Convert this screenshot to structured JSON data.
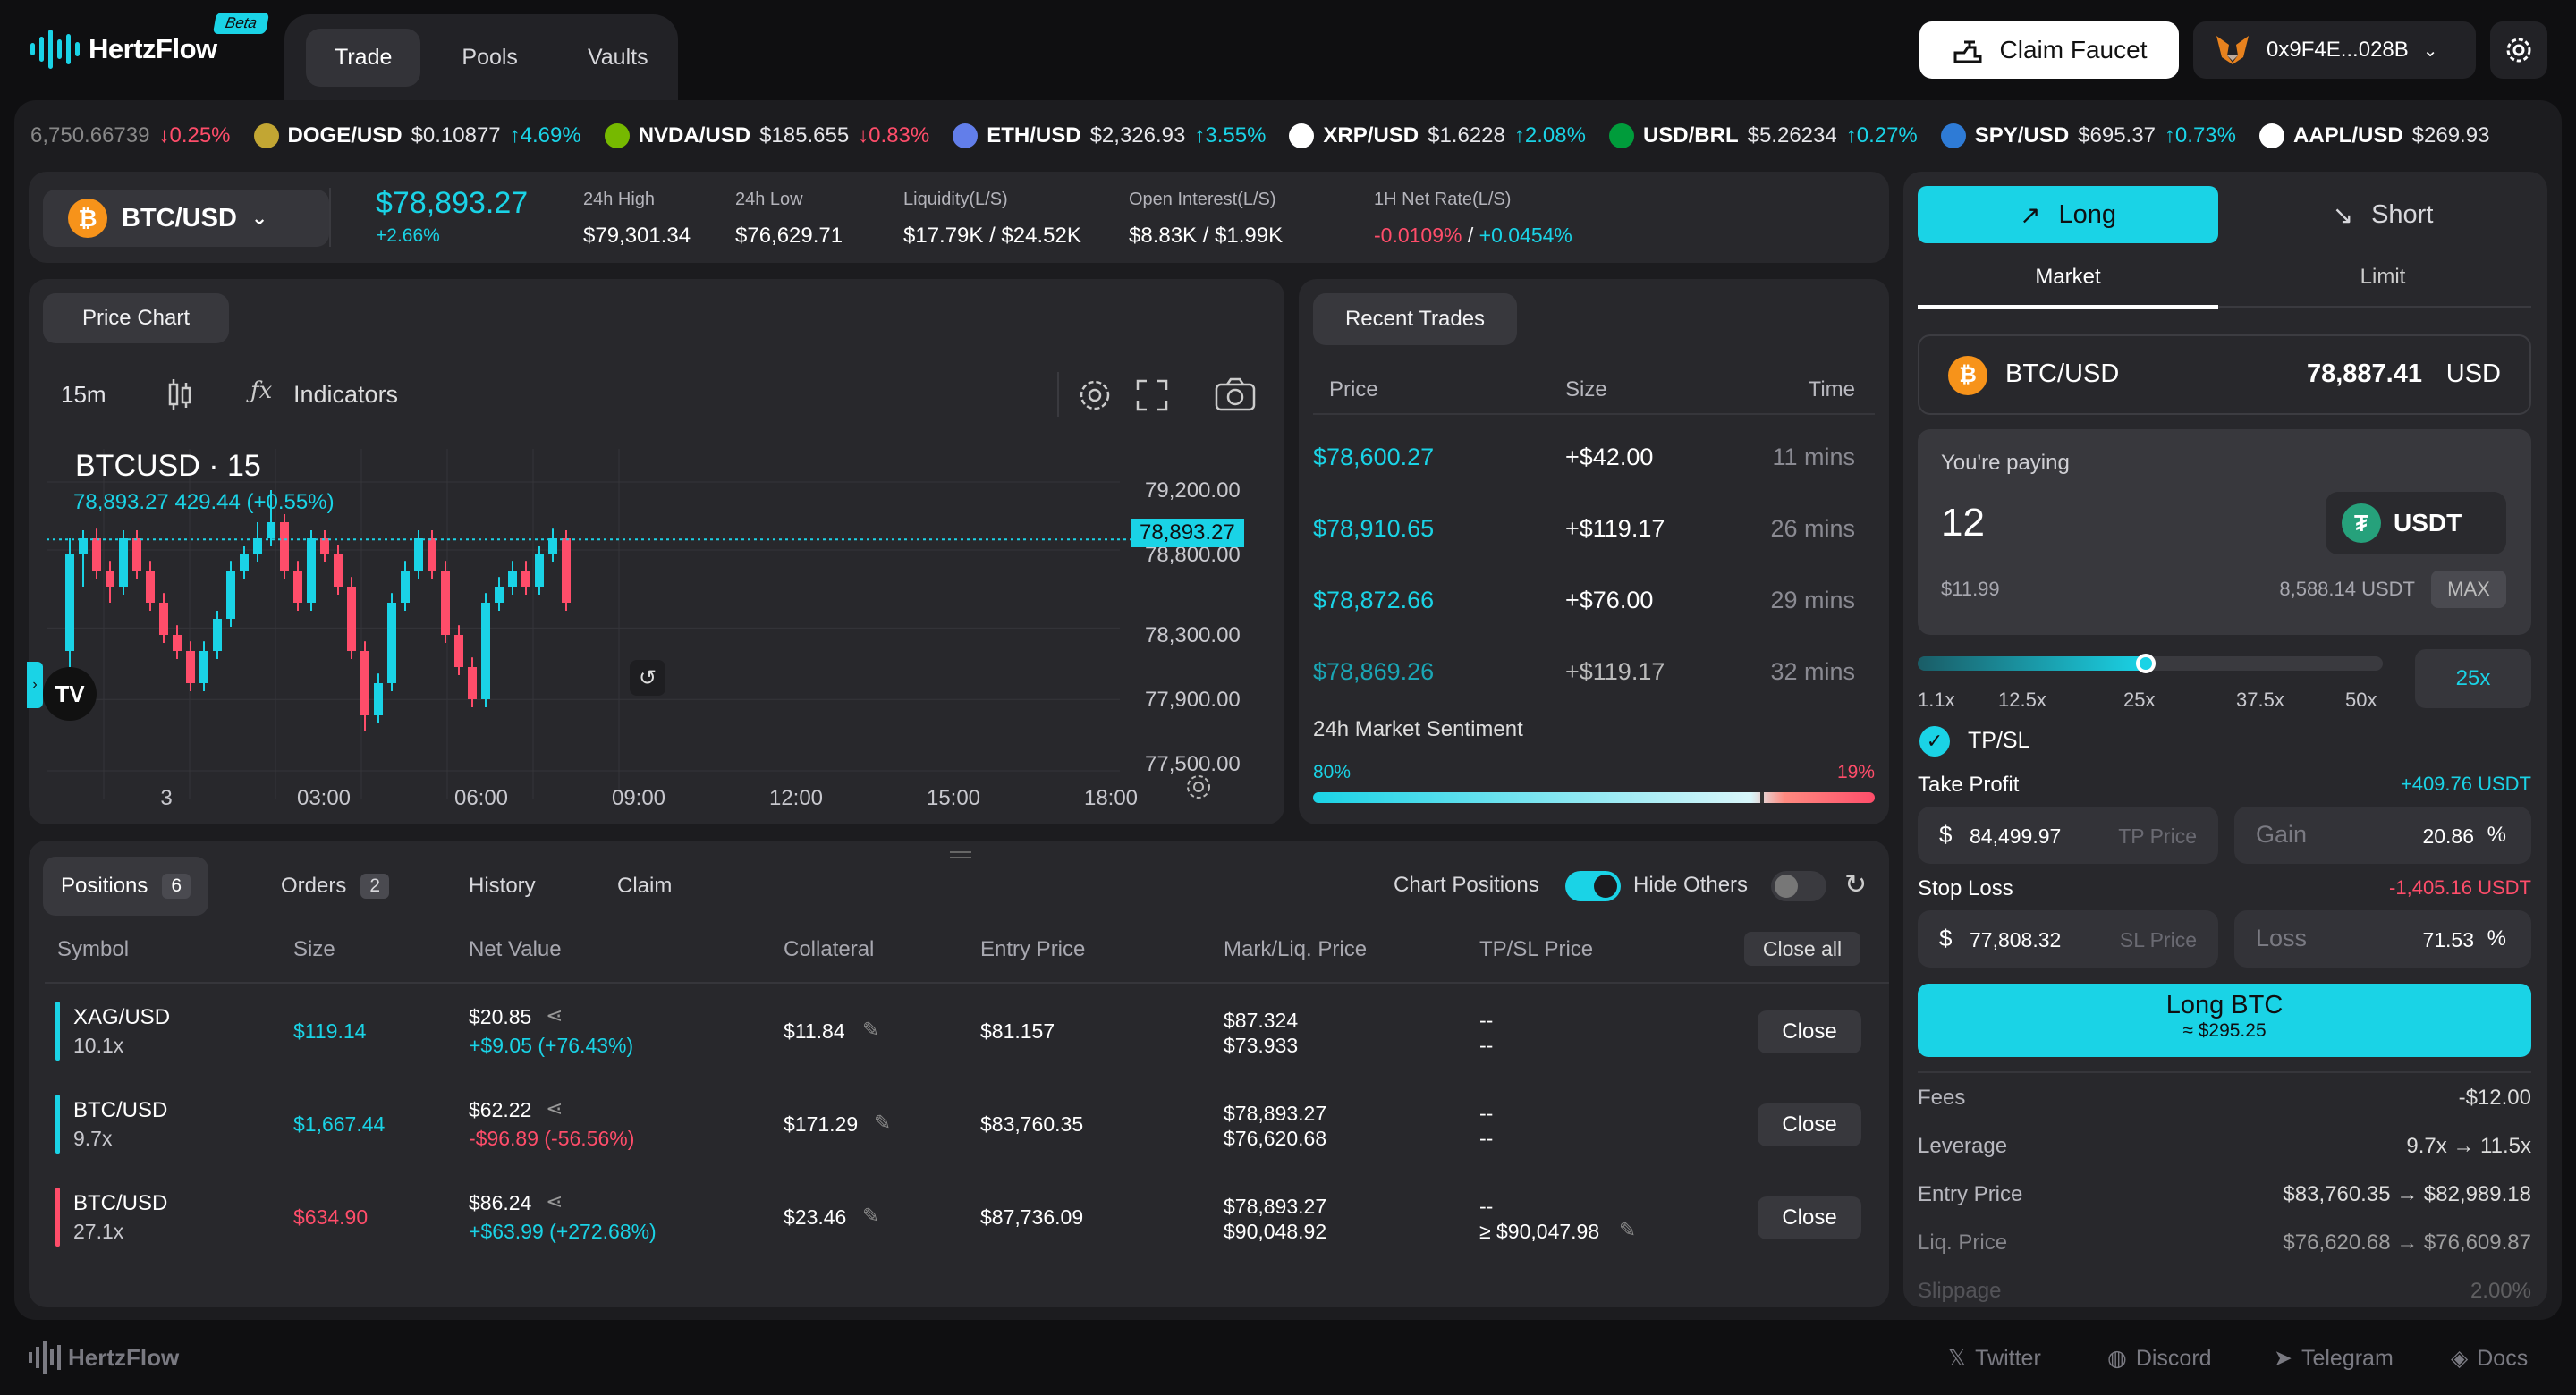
{
  "header": {
    "logo": "HertzFlow",
    "beta": "Beta",
    "tabs": [
      "Trade",
      "Pools",
      "Vaults"
    ],
    "claim_faucet": "Claim Faucet",
    "wallet": "0x9F4E...028B"
  },
  "ticker": [
    {
      "pair": "",
      "price": "6,750.66739",
      "change": "↓0.25%",
      "dir": "down",
      "icon": "none"
    },
    {
      "pair": "DOGE/USD",
      "price": "$0.10877",
      "change": "↑4.69%",
      "dir": "up",
      "icon": "doge-icon",
      "color": "#c2a633"
    },
    {
      "pair": "NVDA/USD",
      "price": "$185.655",
      "change": "↓0.83%",
      "dir": "down",
      "icon": "nvidia-icon",
      "color": "#76b900"
    },
    {
      "pair": "ETH/USD",
      "price": "$2,326.93",
      "change": "↑3.55%",
      "dir": "up",
      "icon": "eth-icon",
      "color": "#627eea"
    },
    {
      "pair": "XRP/USD",
      "price": "$1.6228",
      "change": "↑2.08%",
      "dir": "up",
      "icon": "xrp-icon",
      "color": "#ffffff"
    },
    {
      "pair": "USD/BRL",
      "price": "$5.26234",
      "change": "↑0.27%",
      "dir": "up",
      "icon": "brazil-flag-icon",
      "color": "#009c3b"
    },
    {
      "pair": "SPY/USD",
      "price": "$695.37",
      "change": "↑0.73%",
      "dir": "up",
      "icon": "spy-icon",
      "color": "#2e7bd6"
    },
    {
      "pair": "AAPL/USD",
      "price": "$269.93",
      "change": "",
      "dir": "up",
      "icon": "apple-icon",
      "color": "#ffffff"
    }
  ],
  "stats": {
    "pair": "BTC/USD",
    "price": "$78,893.27",
    "change": "+2.66%",
    "high_label": "24h High",
    "high": "$79,301.34",
    "low_label": "24h Low",
    "low": "$76,629.71",
    "liq_label": "Liquidity(L/S)",
    "liq": "$17.79K / $24.52K",
    "oi_label": "Open Interest(L/S)",
    "oi": "$8.83K / $1.99K",
    "rate_label": "1H Net Rate(L/S)",
    "rate_long": "-0.0109%",
    "rate_sep": " / ",
    "rate_short": "+0.0454%"
  },
  "chart": {
    "tab": "Price Chart",
    "interval": "15m",
    "indicators": "Indicators",
    "symbol": "BTCUSD · 15",
    "ohlc": "78,893.27  429.44 (+0.55%)",
    "price_tag": "78,893.27",
    "y_ticks": [
      "79,200.00",
      "78,800.00",
      "78,300.00",
      "77,900.00",
      "77,500.00"
    ],
    "x_ticks": [
      "3",
      "03:00",
      "06:00",
      "09:00",
      "12:00",
      "15:00",
      "18:00"
    ],
    "brand": "TV"
  },
  "chart_data": {
    "type": "candlestick",
    "title": "BTCUSD · 15",
    "ylim": [
      77400,
      79400
    ],
    "candles": [
      [
        78200,
        78800,
        78100,
        78900
      ],
      [
        78800,
        78900,
        78600,
        78950
      ],
      [
        78900,
        78700,
        78650,
        78960
      ],
      [
        78700,
        78600,
        78500,
        78760
      ],
      [
        78600,
        78900,
        78550,
        78950
      ],
      [
        78900,
        78700,
        78650,
        78950
      ],
      [
        78700,
        78500,
        78450,
        78760
      ],
      [
        78500,
        78300,
        78250,
        78560
      ],
      [
        78300,
        78200,
        78150,
        78360
      ],
      [
        78200,
        78000,
        77950,
        78260
      ],
      [
        78000,
        78200,
        77950,
        78260
      ],
      [
        78200,
        78400,
        78150,
        78450
      ],
      [
        78400,
        78700,
        78350,
        78760
      ],
      [
        78700,
        78800,
        78650,
        78850
      ],
      [
        78800,
        78900,
        78750,
        79000
      ],
      [
        78900,
        79000,
        78850,
        79200
      ],
      [
        79000,
        78700,
        78650,
        79050
      ],
      [
        78700,
        78500,
        78450,
        78760
      ],
      [
        78500,
        78900,
        78450,
        78950
      ],
      [
        78900,
        78800,
        78750,
        78950
      ],
      [
        78800,
        78600,
        78550,
        78860
      ],
      [
        78600,
        78200,
        78150,
        78660
      ],
      [
        78200,
        77800,
        77700,
        78260
      ],
      [
        77800,
        78000,
        77750,
        78060
      ],
      [
        78000,
        78500,
        77950,
        78560
      ],
      [
        78500,
        78700,
        78450,
        78760
      ],
      [
        78700,
        78900,
        78650,
        78950
      ],
      [
        78900,
        78700,
        78650,
        78950
      ],
      [
        78700,
        78300,
        78250,
        78760
      ],
      [
        78300,
        78100,
        78050,
        78360
      ],
      [
        78100,
        77900,
        77850,
        78160
      ],
      [
        77900,
        78500,
        77850,
        78560
      ],
      [
        78500,
        78600,
        78450,
        78660
      ],
      [
        78600,
        78700,
        78550,
        78760
      ],
      [
        78700,
        78600,
        78550,
        78760
      ],
      [
        78600,
        78800,
        78550,
        78850
      ],
      [
        78800,
        78900,
        78750,
        78960
      ],
      [
        78900,
        78500,
        78450,
        78950
      ]
    ]
  },
  "trades": {
    "tab": "Recent Trades",
    "cols": [
      "Price",
      "Size",
      "Time"
    ],
    "rows": [
      [
        "$78,600.27",
        "+$42.00",
        "11 mins"
      ],
      [
        "$78,910.65",
        "+$119.17",
        "26 mins"
      ],
      [
        "$78,872.66",
        "+$76.00",
        "29 mins"
      ],
      [
        "$78,869.26",
        "+$119.17",
        "32 mins"
      ]
    ],
    "sentiment_label": "24h Market Sentiment",
    "long_pct": "80%",
    "short_pct": "19%",
    "long_fraction": 0.8
  },
  "form": {
    "long": "Long",
    "short": "Short",
    "market": "Market",
    "limit": "Limit",
    "pair": "BTC/USD",
    "pair_price": "78,887.41",
    "pair_unit": "USD",
    "paying_label": "You're paying",
    "paying_amount": "12",
    "token": "USDT",
    "paying_usd": "$11.99",
    "balance": "8,588.14 USDT",
    "max": "MAX",
    "leverage_value": "25x",
    "leverage_fraction": 0.49,
    "leverage_ticks": [
      "1.1x",
      "12.5x",
      "25x",
      "37.5x",
      "50x"
    ],
    "tpsl": "TP/SL",
    "tp_label": "Take Profit",
    "tp_gain": "+409.76 USDT",
    "tp_price": "84,499.97",
    "tp_placeholder": "TP Price",
    "gain_label": "Gain",
    "gain_value": "20.86",
    "pct": "%",
    "sl_label": "Stop Loss",
    "sl_loss": "-1,405.16 USDT",
    "sl_price": "77,808.32",
    "sl_placeholder": "SL Price",
    "loss_label": "Loss",
    "loss_value": "71.53",
    "submit": "Long BTC",
    "submit_sub": "≈ $295.25",
    "details": [
      [
        "Fees",
        "-$12.00"
      ],
      [
        "Leverage",
        "9.7x → 11.5x"
      ],
      [
        "Entry Price",
        "$83,760.35 → $82,989.18"
      ],
      [
        "Liq. Price",
        "$76,620.68 → $76,609.87"
      ],
      [
        "Slippage",
        "2.00%"
      ]
    ]
  },
  "positions": {
    "tabs": [
      {
        "label": "Positions",
        "count": "6"
      },
      {
        "label": "Orders",
        "count": "2"
      },
      {
        "label": "History",
        "count": ""
      },
      {
        "label": "Claim",
        "count": ""
      }
    ],
    "chart_positions": "Chart Positions",
    "hide_others": "Hide Others",
    "cols": [
      "Symbol",
      "Size",
      "Net Value",
      "Collateral",
      "Entry Price",
      "Mark/Liq. Price",
      "TP/SL Price"
    ],
    "close_all": "Close all",
    "rows": [
      {
        "symbol": "XAG/USD",
        "lev": "10.1x",
        "side": "long",
        "size": "$119.14",
        "net": "$20.85",
        "pnl": "+$9.05 (+76.43%)",
        "pnl_dir": "up",
        "collateral": "$11.84",
        "entry": "$81.157",
        "mark": "$87.324",
        "liq": "$73.933",
        "tp": "--",
        "sl": "--",
        "close": "Close"
      },
      {
        "symbol": "BTC/USD",
        "lev": "9.7x",
        "side": "long",
        "size": "$1,667.44",
        "net": "$62.22",
        "pnl": "-$96.89 (-56.56%)",
        "pnl_dir": "down",
        "collateral": "$171.29",
        "entry": "$83,760.35",
        "mark": "$78,893.27",
        "liq": "$76,620.68",
        "tp": "--",
        "sl": "--",
        "close": "Close"
      },
      {
        "symbol": "BTC/USD",
        "lev": "27.1x",
        "side": "short",
        "size": "$634.90",
        "net": "$86.24",
        "pnl": "+$63.99 (+272.68%)",
        "pnl_dir": "up",
        "collateral": "$23.46",
        "entry": "$87,736.09",
        "mark": "$78,893.27",
        "liq": "$90,048.92",
        "tp": "--",
        "sl": "≥ $90,047.98",
        "close": "Close"
      }
    ]
  },
  "footer": {
    "logo": "HertzFlow",
    "links": [
      "Twitter",
      "Discord",
      "Telegram",
      "Docs"
    ]
  }
}
